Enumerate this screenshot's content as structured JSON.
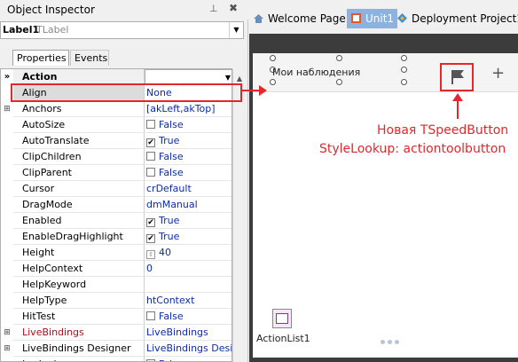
{
  "inspector": {
    "title": "Object Inspector",
    "pin": "⊥",
    "close": "✖",
    "component_name": "Label1",
    "component_type": "TLabel",
    "tabs": [
      "Properties",
      "Events"
    ],
    "properties": [
      {
        "name": "Action",
        "value": "",
        "gutter": "»",
        "header": true
      },
      {
        "name": "Align",
        "value": "None",
        "gutter": ""
      },
      {
        "name": "Anchors",
        "value": "[akLeft,akTop]",
        "gutter": "⊞"
      },
      {
        "name": "AutoSize",
        "value": "False",
        "check": false
      },
      {
        "name": "AutoTranslate",
        "value": "True",
        "check": true
      },
      {
        "name": "ClipChildren",
        "value": "False",
        "check": false
      },
      {
        "name": "ClipParent",
        "value": "False",
        "check": false
      },
      {
        "name": "Cursor",
        "value": "crDefault"
      },
      {
        "name": "DragMode",
        "value": "dmManual"
      },
      {
        "name": "Enabled",
        "value": "True",
        "check": true
      },
      {
        "name": "EnableDragHighlight",
        "value": "True",
        "check": true
      },
      {
        "name": "Height",
        "value": "40",
        "spin": true
      },
      {
        "name": "HelpContext",
        "value": "0"
      },
      {
        "name": "HelpKeyword",
        "value": ""
      },
      {
        "name": "HelpType",
        "value": "htContext"
      },
      {
        "name": "HitTest",
        "value": "False",
        "check": false
      },
      {
        "name": "LiveBindings",
        "value": "LiveBindings",
        "gutter": "⊞",
        "red": true
      },
      {
        "name": "LiveBindings Designer",
        "value": "LiveBindings Desig",
        "gutter": "⊞"
      },
      {
        "name": "Locked",
        "value": "False",
        "check": false
      }
    ]
  },
  "tabs": {
    "welcome": "Welcome Page",
    "unit": "Unit1",
    "deploy": "Deployment Project1"
  },
  "designer": {
    "toolbar_label": "Мои наблюдения",
    "plus": "+",
    "note_line1": "Новая TSpeedButton",
    "note_line2": "StyleLookup: actiontoolbutton",
    "component_label": "ActionList1"
  },
  "colors": {
    "accent_red": "#e3272d",
    "value_blue": "#0b2ca8"
  }
}
